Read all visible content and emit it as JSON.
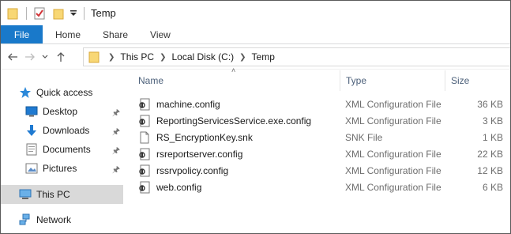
{
  "window": {
    "title": "Temp",
    "quick_access_toolbar": [
      "folder-icon",
      "properties-icon",
      "new-folder-icon",
      "customize-dropdown-icon"
    ]
  },
  "ribbon": {
    "tabs": [
      {
        "label": "File",
        "active": true
      },
      {
        "label": "Home"
      },
      {
        "label": "Share"
      },
      {
        "label": "View"
      }
    ],
    "accent_color": "#1979ca"
  },
  "address": {
    "back": "back-arrow-icon",
    "forward": "forward-arrow-icon",
    "recent": "recent-locations-icon",
    "up": "up-arrow-icon",
    "breadcrumbs": [
      "This PC",
      "Local Disk (C:)",
      "Temp"
    ]
  },
  "nav": {
    "items": [
      {
        "label": "Quick access",
        "icon": "star-icon",
        "pinned": false,
        "selected": false
      },
      {
        "label": "Desktop",
        "icon": "desktop-icon",
        "pinned": true,
        "selected": false
      },
      {
        "label": "Downloads",
        "icon": "download-icon",
        "pinned": true,
        "selected": false
      },
      {
        "label": "Documents",
        "icon": "documents-icon",
        "pinned": true,
        "selected": false
      },
      {
        "label": "Pictures",
        "icon": "pictures-icon",
        "pinned": true,
        "selected": false
      },
      {
        "label": "This PC",
        "icon": "computer-icon",
        "pinned": false,
        "selected": true
      },
      {
        "label": "Network",
        "icon": "network-icon",
        "pinned": false,
        "selected": false
      }
    ]
  },
  "file_list": {
    "columns": {
      "name": "Name",
      "type": "Type",
      "size": "Size"
    },
    "sorted_by": "Name",
    "files": [
      {
        "name": "machine.config",
        "type": "XML Configuration File",
        "size": "36 KB",
        "icon": "config-file-icon"
      },
      {
        "name": "ReportingServicesService.exe.config",
        "type": "XML Configuration File",
        "size": "3 KB",
        "icon": "config-file-icon"
      },
      {
        "name": "RS_EncryptionKey.snk",
        "type": "SNK File",
        "size": "1 KB",
        "icon": "blank-file-icon"
      },
      {
        "name": "rsreportserver.config",
        "type": "XML Configuration File",
        "size": "22 KB",
        "icon": "config-file-icon"
      },
      {
        "name": "rssrvpolicy.config",
        "type": "XML Configuration File",
        "size": "12 KB",
        "icon": "config-file-icon"
      },
      {
        "name": "web.config",
        "type": "XML Configuration File",
        "size": "6 KB",
        "icon": "config-file-icon"
      }
    ]
  }
}
